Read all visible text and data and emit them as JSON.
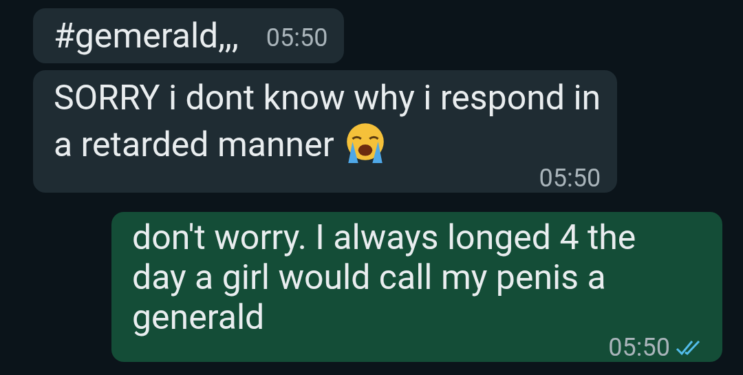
{
  "messages": [
    {
      "kind": "incoming",
      "lines": [
        "#gemerald,,,"
      ],
      "time": "05:50"
    },
    {
      "kind": "incoming",
      "lines": [
        "SORRY i dont know why i respond in",
        "a retarded manner"
      ],
      "time": "05:50",
      "trailing_emoji": true
    },
    {
      "kind": "outgoing",
      "lines": [
        "don't worry. I always longed 4 the",
        "day a girl would call my penis a",
        "generald"
      ],
      "time": "05:50",
      "read": true
    }
  ]
}
